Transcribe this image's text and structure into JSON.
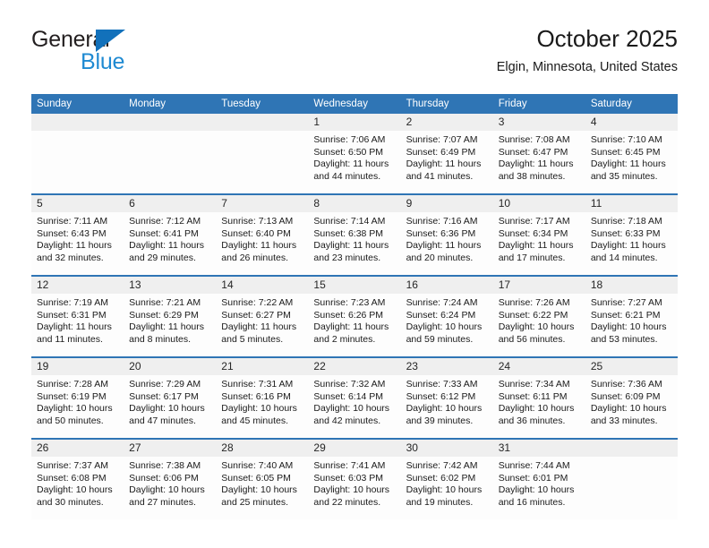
{
  "brand": {
    "name_part1": "General",
    "name_part2": "Blue",
    "triangle_color": "#1271bb",
    "blue_color": "#1f8ad2",
    "dark_color": "#231f20"
  },
  "header": {
    "title": "October 2025",
    "subtitle": "Elgin, Minnesota, United States"
  },
  "theme": {
    "header_row_bg": "#2f75b5",
    "day_band_bg": "#efefef",
    "cell_bg": "#fdfdfd",
    "text_color": "#1a1a1a"
  },
  "weekday_headers": [
    "Sunday",
    "Monday",
    "Tuesday",
    "Wednesday",
    "Thursday",
    "Friday",
    "Saturday"
  ],
  "weeks": [
    [
      {
        "day": "",
        "empty": true
      },
      {
        "day": "",
        "empty": true
      },
      {
        "day": "",
        "empty": true
      },
      {
        "day": "1",
        "sunrise": "Sunrise: 7:06 AM",
        "sunset": "Sunset: 6:50 PM",
        "daylight_1": "Daylight: 11 hours",
        "daylight_2": "and 44 minutes."
      },
      {
        "day": "2",
        "sunrise": "Sunrise: 7:07 AM",
        "sunset": "Sunset: 6:49 PM",
        "daylight_1": "Daylight: 11 hours",
        "daylight_2": "and 41 minutes."
      },
      {
        "day": "3",
        "sunrise": "Sunrise: 7:08 AM",
        "sunset": "Sunset: 6:47 PM",
        "daylight_1": "Daylight: 11 hours",
        "daylight_2": "and 38 minutes."
      },
      {
        "day": "4",
        "sunrise": "Sunrise: 7:10 AM",
        "sunset": "Sunset: 6:45 PM",
        "daylight_1": "Daylight: 11 hours",
        "daylight_2": "and 35 minutes."
      }
    ],
    [
      {
        "day": "5",
        "sunrise": "Sunrise: 7:11 AM",
        "sunset": "Sunset: 6:43 PM",
        "daylight_1": "Daylight: 11 hours",
        "daylight_2": "and 32 minutes."
      },
      {
        "day": "6",
        "sunrise": "Sunrise: 7:12 AM",
        "sunset": "Sunset: 6:41 PM",
        "daylight_1": "Daylight: 11 hours",
        "daylight_2": "and 29 minutes."
      },
      {
        "day": "7",
        "sunrise": "Sunrise: 7:13 AM",
        "sunset": "Sunset: 6:40 PM",
        "daylight_1": "Daylight: 11 hours",
        "daylight_2": "and 26 minutes."
      },
      {
        "day": "8",
        "sunrise": "Sunrise: 7:14 AM",
        "sunset": "Sunset: 6:38 PM",
        "daylight_1": "Daylight: 11 hours",
        "daylight_2": "and 23 minutes."
      },
      {
        "day": "9",
        "sunrise": "Sunrise: 7:16 AM",
        "sunset": "Sunset: 6:36 PM",
        "daylight_1": "Daylight: 11 hours",
        "daylight_2": "and 20 minutes."
      },
      {
        "day": "10",
        "sunrise": "Sunrise: 7:17 AM",
        "sunset": "Sunset: 6:34 PM",
        "daylight_1": "Daylight: 11 hours",
        "daylight_2": "and 17 minutes."
      },
      {
        "day": "11",
        "sunrise": "Sunrise: 7:18 AM",
        "sunset": "Sunset: 6:33 PM",
        "daylight_1": "Daylight: 11 hours",
        "daylight_2": "and 14 minutes."
      }
    ],
    [
      {
        "day": "12",
        "sunrise": "Sunrise: 7:19 AM",
        "sunset": "Sunset: 6:31 PM",
        "daylight_1": "Daylight: 11 hours",
        "daylight_2": "and 11 minutes."
      },
      {
        "day": "13",
        "sunrise": "Sunrise: 7:21 AM",
        "sunset": "Sunset: 6:29 PM",
        "daylight_1": "Daylight: 11 hours",
        "daylight_2": "and 8 minutes."
      },
      {
        "day": "14",
        "sunrise": "Sunrise: 7:22 AM",
        "sunset": "Sunset: 6:27 PM",
        "daylight_1": "Daylight: 11 hours",
        "daylight_2": "and 5 minutes."
      },
      {
        "day": "15",
        "sunrise": "Sunrise: 7:23 AM",
        "sunset": "Sunset: 6:26 PM",
        "daylight_1": "Daylight: 11 hours",
        "daylight_2": "and 2 minutes."
      },
      {
        "day": "16",
        "sunrise": "Sunrise: 7:24 AM",
        "sunset": "Sunset: 6:24 PM",
        "daylight_1": "Daylight: 10 hours",
        "daylight_2": "and 59 minutes."
      },
      {
        "day": "17",
        "sunrise": "Sunrise: 7:26 AM",
        "sunset": "Sunset: 6:22 PM",
        "daylight_1": "Daylight: 10 hours",
        "daylight_2": "and 56 minutes."
      },
      {
        "day": "18",
        "sunrise": "Sunrise: 7:27 AM",
        "sunset": "Sunset: 6:21 PM",
        "daylight_1": "Daylight: 10 hours",
        "daylight_2": "and 53 minutes."
      }
    ],
    [
      {
        "day": "19",
        "sunrise": "Sunrise: 7:28 AM",
        "sunset": "Sunset: 6:19 PM",
        "daylight_1": "Daylight: 10 hours",
        "daylight_2": "and 50 minutes."
      },
      {
        "day": "20",
        "sunrise": "Sunrise: 7:29 AM",
        "sunset": "Sunset: 6:17 PM",
        "daylight_1": "Daylight: 10 hours",
        "daylight_2": "and 47 minutes."
      },
      {
        "day": "21",
        "sunrise": "Sunrise: 7:31 AM",
        "sunset": "Sunset: 6:16 PM",
        "daylight_1": "Daylight: 10 hours",
        "daylight_2": "and 45 minutes."
      },
      {
        "day": "22",
        "sunrise": "Sunrise: 7:32 AM",
        "sunset": "Sunset: 6:14 PM",
        "daylight_1": "Daylight: 10 hours",
        "daylight_2": "and 42 minutes."
      },
      {
        "day": "23",
        "sunrise": "Sunrise: 7:33 AM",
        "sunset": "Sunset: 6:12 PM",
        "daylight_1": "Daylight: 10 hours",
        "daylight_2": "and 39 minutes."
      },
      {
        "day": "24",
        "sunrise": "Sunrise: 7:34 AM",
        "sunset": "Sunset: 6:11 PM",
        "daylight_1": "Daylight: 10 hours",
        "daylight_2": "and 36 minutes."
      },
      {
        "day": "25",
        "sunrise": "Sunrise: 7:36 AM",
        "sunset": "Sunset: 6:09 PM",
        "daylight_1": "Daylight: 10 hours",
        "daylight_2": "and 33 minutes."
      }
    ],
    [
      {
        "day": "26",
        "sunrise": "Sunrise: 7:37 AM",
        "sunset": "Sunset: 6:08 PM",
        "daylight_1": "Daylight: 10 hours",
        "daylight_2": "and 30 minutes."
      },
      {
        "day": "27",
        "sunrise": "Sunrise: 7:38 AM",
        "sunset": "Sunset: 6:06 PM",
        "daylight_1": "Daylight: 10 hours",
        "daylight_2": "and 27 minutes."
      },
      {
        "day": "28",
        "sunrise": "Sunrise: 7:40 AM",
        "sunset": "Sunset: 6:05 PM",
        "daylight_1": "Daylight: 10 hours",
        "daylight_2": "and 25 minutes."
      },
      {
        "day": "29",
        "sunrise": "Sunrise: 7:41 AM",
        "sunset": "Sunset: 6:03 PM",
        "daylight_1": "Daylight: 10 hours",
        "daylight_2": "and 22 minutes."
      },
      {
        "day": "30",
        "sunrise": "Sunrise: 7:42 AM",
        "sunset": "Sunset: 6:02 PM",
        "daylight_1": "Daylight: 10 hours",
        "daylight_2": "and 19 minutes."
      },
      {
        "day": "31",
        "sunrise": "Sunrise: 7:44 AM",
        "sunset": "Sunset: 6:01 PM",
        "daylight_1": "Daylight: 10 hours",
        "daylight_2": "and 16 minutes."
      },
      {
        "day": "",
        "empty": true
      }
    ]
  ]
}
